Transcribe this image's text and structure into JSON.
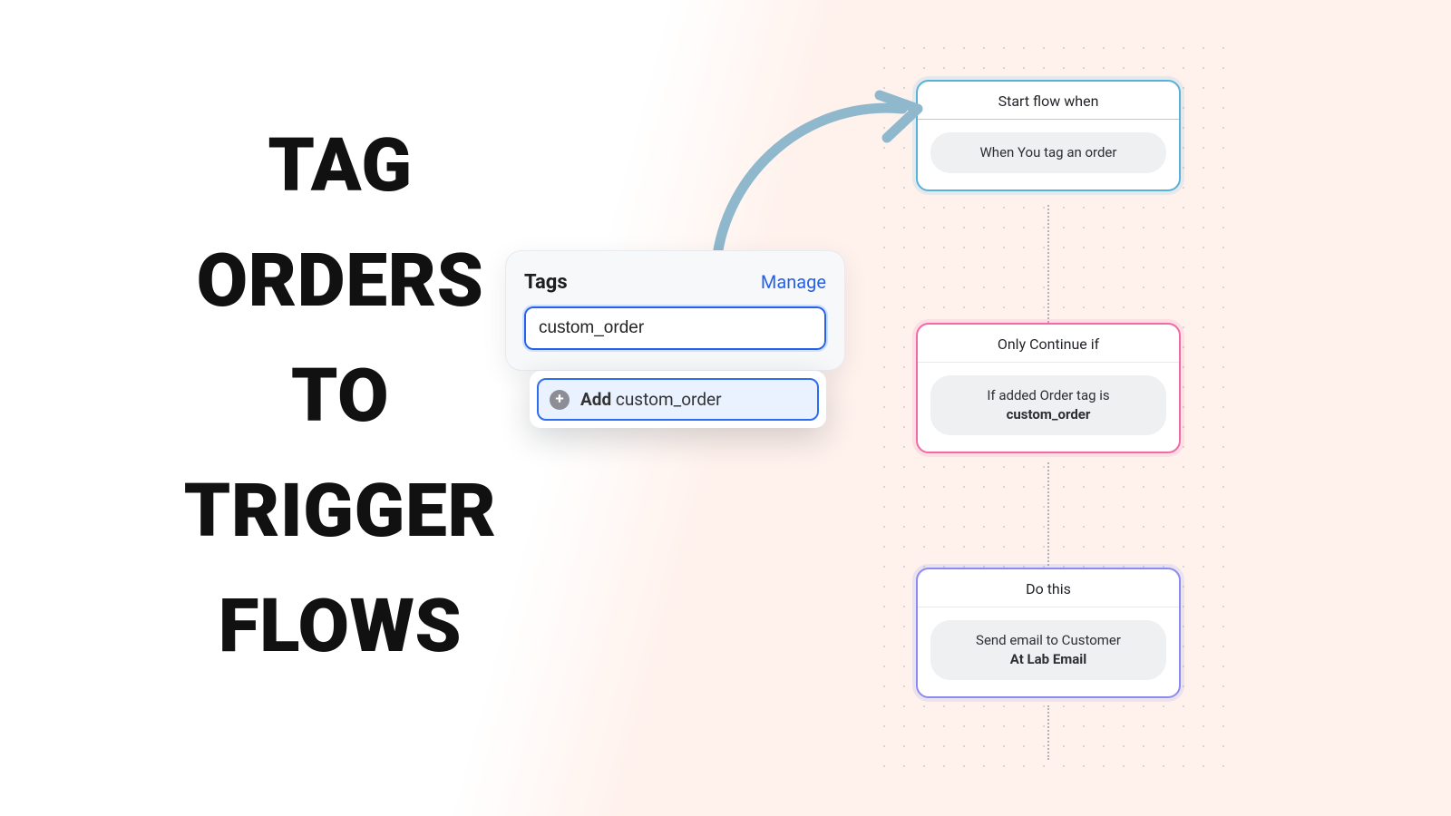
{
  "headline": "TAG ORDERS TO TRIGGER FLOWS",
  "tags_panel": {
    "title": "Tags",
    "manage_label": "Manage",
    "input_value": "custom_order",
    "add_prefix": "Add",
    "add_value": "custom_order"
  },
  "flow": {
    "nodes": [
      {
        "header": "Start flow when",
        "pill_lines": [
          "When You tag an order"
        ],
        "bold_line": null
      },
      {
        "header": "Only Continue if",
        "pill_lines": [
          "If added Order tag is"
        ],
        "bold_line": "custom_order"
      },
      {
        "header": "Do this",
        "pill_lines": [
          "Send email to Customer"
        ],
        "bold_line": "At Lab Email"
      }
    ]
  },
  "colors": {
    "node1_border": "#57b2d9",
    "node2_border": "#f06aa8",
    "node3_border": "#8b8cf2",
    "link_blue": "#2761e8"
  }
}
